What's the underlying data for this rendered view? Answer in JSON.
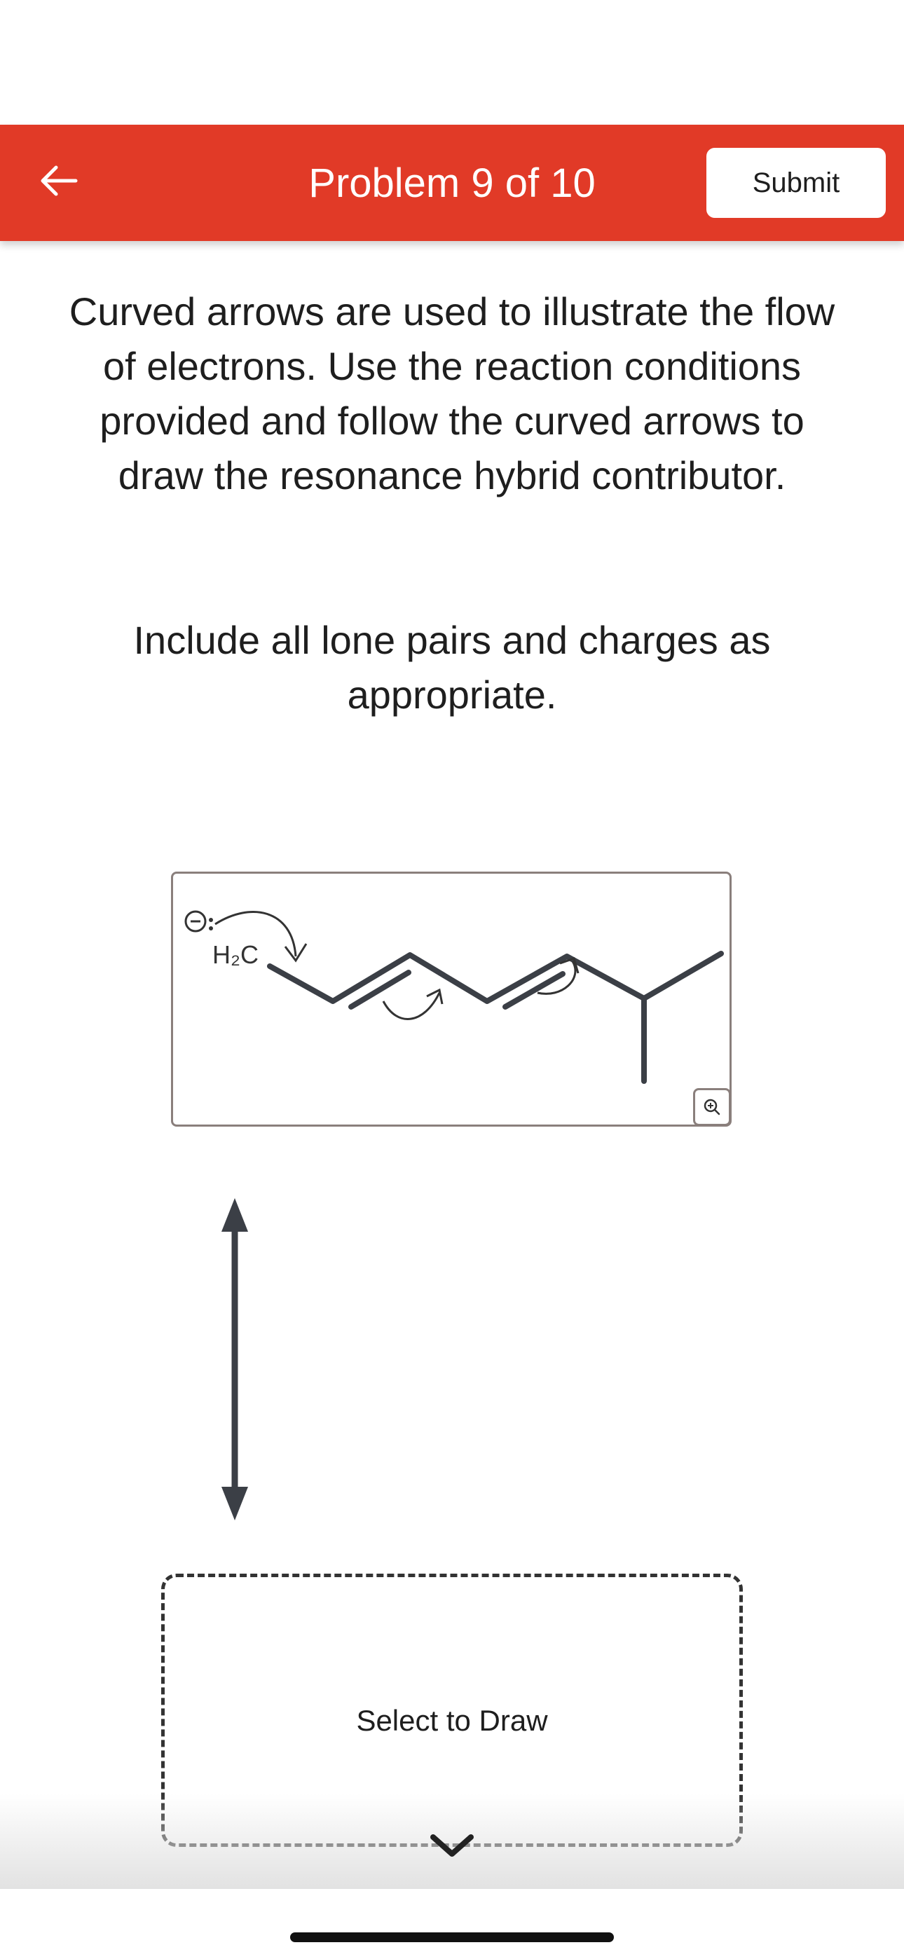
{
  "header": {
    "title": "Problem 9 of 10",
    "submit_label": "Submit",
    "back_icon": "arrow-left-icon",
    "background_color": "#e13a27"
  },
  "instructions": {
    "main": "Curved arrows are used to illustrate the flow of electrons. Use the reaction conditions provided and follow the curved arrows to draw the resonance hybrid contributor.",
    "secondary": "Include all lone pairs and charges as appropriate."
  },
  "molecule": {
    "carbanion_label": "H₂C",
    "charge_symbol": "negative-charge-icon",
    "zoom_icon": "zoom-in-icon"
  },
  "resonance_arrow_icon": "double-headed-arrow-icon",
  "draw_area": {
    "label": "Select to Draw",
    "expand_icon": "chevron-down-icon"
  }
}
